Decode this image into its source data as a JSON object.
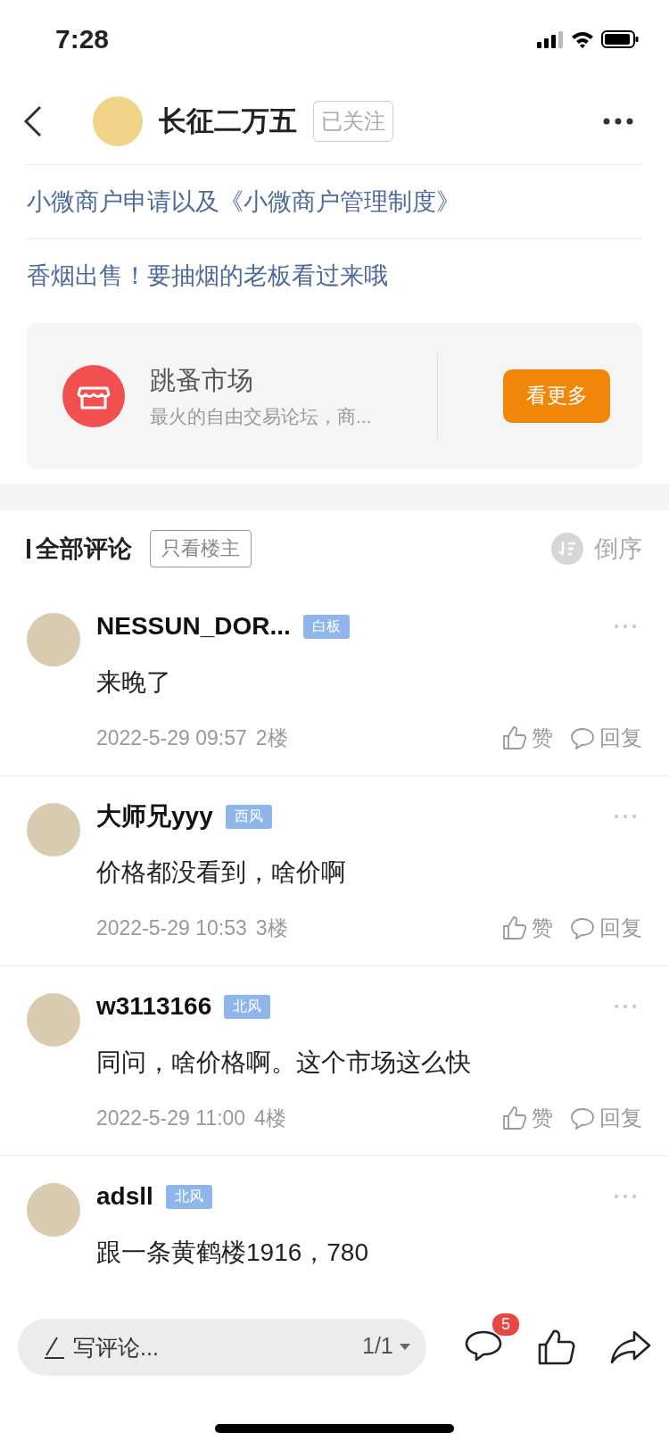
{
  "status_bar": {
    "time": "7:28"
  },
  "header": {
    "username": "长征二万五",
    "follow_label": "已关注"
  },
  "related_links": [
    "小微商户申请以及《小微商户管理制度》",
    "香烟出售！要抽烟的老板看过来哦"
  ],
  "forum_card": {
    "name": "跳蚤市场",
    "description": "最火的自由交易论坛，商...",
    "button": "看更多"
  },
  "comments_header": {
    "title": "全部评论",
    "filter": "只看楼主",
    "sort": "倒序"
  },
  "comments": [
    {
      "name": "NESSUN_DOR...",
      "badge": "白板",
      "text": "来晚了",
      "time": "2022-5-29 09:57",
      "floor": "2楼",
      "like_label": "赞",
      "reply_label": "回复"
    },
    {
      "name": "大师兄yyy",
      "badge": "西风",
      "text": "价格都没看到，啥价啊",
      "time": "2022-5-29 10:53",
      "floor": "3楼",
      "like_label": "赞",
      "reply_label": "回复"
    },
    {
      "name": "w3113166",
      "badge": "北风",
      "text": "同问，啥价格啊。这个市场这么快",
      "time": "2022-5-29 11:00",
      "floor": "4楼",
      "like_label": "赞",
      "reply_label": "回复"
    },
    {
      "name": "adsll",
      "badge": "北风",
      "text": "跟一条黄鹤楼1916，780"
    }
  ],
  "bottom_bar": {
    "placeholder": "写评论...",
    "page": "1/1",
    "comment_count": "5"
  }
}
